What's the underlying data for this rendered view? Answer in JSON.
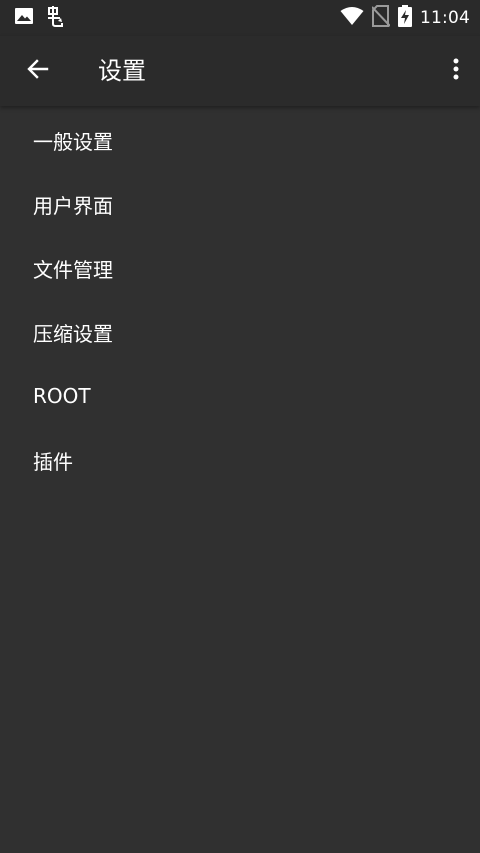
{
  "status_bar": {
    "time": "11:04",
    "icons": [
      "image-icon",
      "bug-icon",
      "wifi-icon",
      "no-sim-icon",
      "battery-charging-icon"
    ]
  },
  "app_bar": {
    "title": "设置",
    "back_icon": "arrow-back-icon",
    "overflow_icon": "more-vert-icon"
  },
  "menu": {
    "items": [
      {
        "label": "一般设置"
      },
      {
        "label": "用户界面"
      },
      {
        "label": "文件管理"
      },
      {
        "label": "压缩设置"
      },
      {
        "label": "ROOT"
      },
      {
        "label": "插件"
      }
    ]
  },
  "colors": {
    "background": "#303030",
    "app_bar": "#2b2b2b",
    "text": "#ffffff"
  }
}
